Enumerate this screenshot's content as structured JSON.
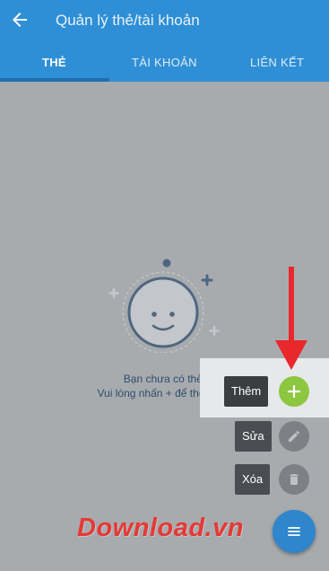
{
  "header": {
    "title": "Quản lý thẻ/tài khoản",
    "tabs": [
      {
        "label": "THẺ",
        "active": true
      },
      {
        "label": "TÀI KHOẢN",
        "active": false
      },
      {
        "label": "LIÊN KẾT",
        "active": false
      }
    ]
  },
  "empty_state": {
    "line1": "Bạn chưa có thẻ.",
    "line2": "Vui lòng nhấn + để thêm thẻ"
  },
  "fab_menu": {
    "add_label": "Thêm",
    "edit_label": "Sửa",
    "delete_label": "Xóa"
  },
  "watermark": "Download.vn",
  "colors": {
    "app_bar": "#2f8fd6",
    "add_fab": "#8dc63f",
    "main_fab": "#2f86cc",
    "arrow": "#e8282b"
  }
}
